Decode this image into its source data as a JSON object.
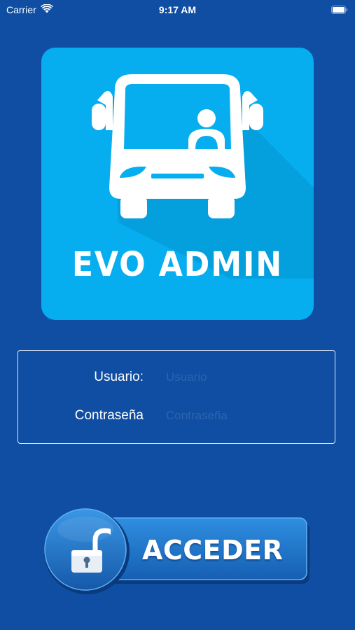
{
  "status_bar": {
    "carrier": "Carrier",
    "time": "9:17 AM",
    "wifi_icon": "wifi-icon",
    "battery_icon": "battery-icon"
  },
  "logo": {
    "text": "EVO ADMIN",
    "icon": "bus-driver-icon",
    "background_color": "#06aef0"
  },
  "form": {
    "username_label": "Usuario:",
    "username_value": "",
    "username_placeholder": "Usuario",
    "password_label": "Contraseña",
    "password_value": "",
    "password_placeholder": "Contraseña"
  },
  "action": {
    "button_label": "ACCEDER",
    "icon": "unlocked-padlock-icon"
  },
  "colors": {
    "background": "#0f4ea3",
    "button_main": "#1a74c9",
    "text": "#ffffff"
  }
}
